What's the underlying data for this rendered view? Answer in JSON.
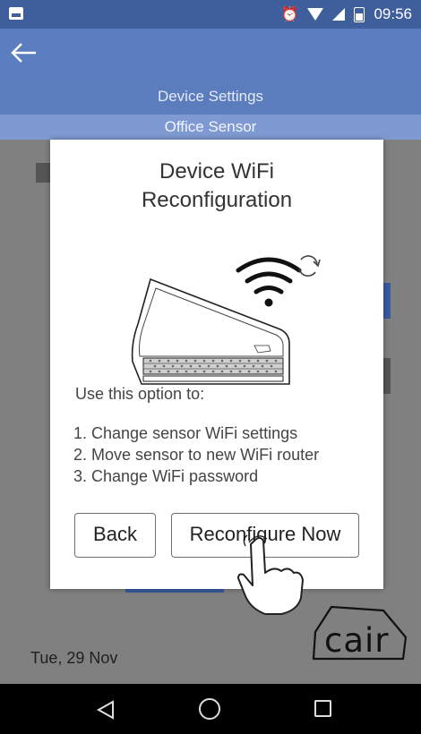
{
  "status_bar": {
    "time": "09:56",
    "alarm_icon": "alarm-clock-icon",
    "wifi_icon": "wifi-icon",
    "signal_icon": "cellular-signal-icon",
    "battery_icon": "battery-icon",
    "notification_icon": "image-notification-icon"
  },
  "header": {
    "back_icon": "arrow-left-icon",
    "title": "Device Settings",
    "subtitle": "Office Sensor"
  },
  "dialog": {
    "title_line1": "Device WiFi",
    "title_line2": "Reconfiguration",
    "illustration_icon": "sensor-device-wifi-refresh-icon",
    "intro": "Use this option to:",
    "steps": [
      "1. Change sensor WiFi settings",
      "2. Move sensor to new WiFi router",
      "3. Change WiFi password"
    ],
    "back_label": "Back",
    "reconfigure_label": "Reconfigure Now"
  },
  "background": {
    "date": "Tue, 29 Nov",
    "logo_text": "cair"
  },
  "navigation": {
    "back_icon": "nav-back-triangle-icon",
    "home_icon": "nav-home-circle-icon",
    "recent_icon": "nav-recent-square-icon"
  },
  "colors": {
    "status_bar": "#3f5e9c",
    "app_bar": "#5a7ec0",
    "subtitle_bar": "#7f9ad2",
    "dim_overlay": "#808080"
  }
}
